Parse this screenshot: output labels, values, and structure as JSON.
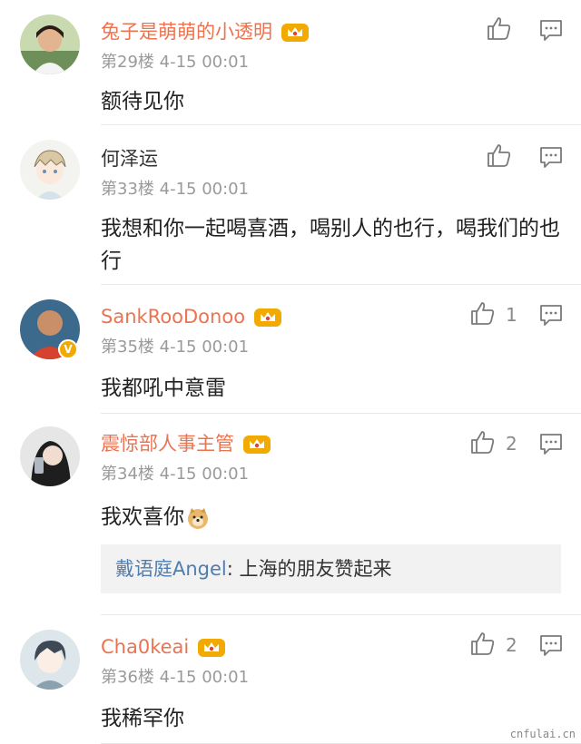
{
  "comments": [
    {
      "name": "兔子是萌萌的小透明",
      "floor": "第29楼",
      "date": "4-15 00:01",
      "text": "额待见你",
      "likes": ""
    },
    {
      "name": "何泽运",
      "floor": "第33楼",
      "date": "4-15 00:01",
      "text": "我想和你一起喝喜酒，喝别人的也行，喝我们的也行",
      "likes": ""
    },
    {
      "name": "SankRooDonoo",
      "floor": "第35楼",
      "date": "4-15 00:01",
      "text": "我都吼中意雷",
      "likes": "1"
    },
    {
      "name": "震惊部人事主管",
      "floor": "第34楼",
      "date": "4-15 00:01",
      "text": "我欢喜你",
      "likes": "2",
      "reply": {
        "user": "戴语庭Angel",
        "separator": ":",
        "text": " 上海的朋友赞起来"
      }
    },
    {
      "name": "Cha0keai",
      "floor": "第36楼",
      "date": "4-15 00:01",
      "text": "我稀罕你",
      "likes": "2"
    }
  ],
  "icons": {
    "like": "thumbs-up-icon",
    "reply": "comment-icon",
    "crown": "vip-crown-icon",
    "verified": "verified-badge-icon",
    "emoji": "doge-emoji-icon"
  },
  "colors": {
    "name": "#eb7350",
    "meta": "#9a9a9a",
    "reply_user": "#507daf",
    "crown": "#f2a900"
  },
  "watermark": "cnfulai.cn"
}
